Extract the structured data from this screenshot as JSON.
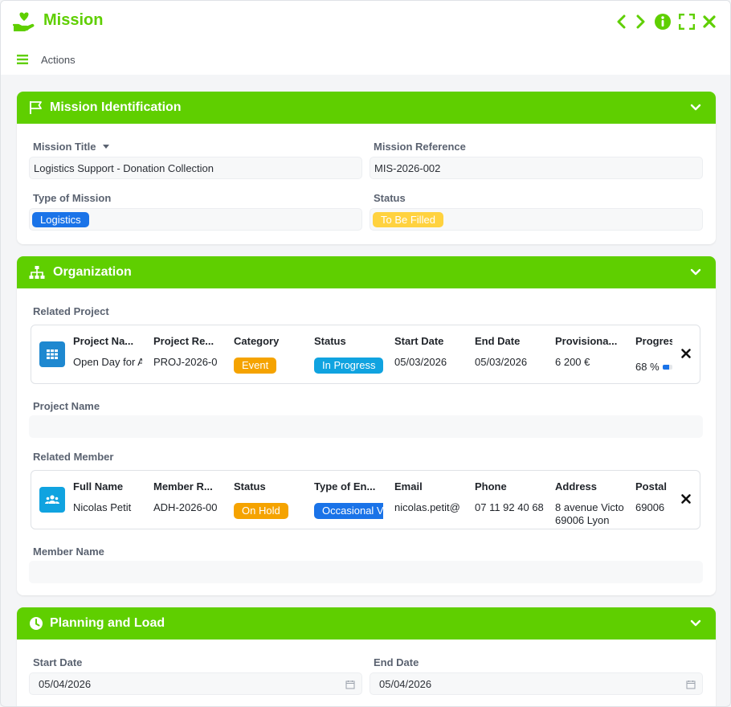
{
  "app": {
    "title": "Mission",
    "actions_label": "Actions"
  },
  "colors": {
    "accent": "#5fcf00",
    "blue": "#1a73e8",
    "cyan": "#10a3e0",
    "orange": "#f5a300",
    "yellow": "#ffd23f"
  },
  "identification": {
    "title": "Mission Identification",
    "mission_title_label": "Mission Title",
    "mission_title_value": "Logistics Support - Donation Collection",
    "reference_label": "Mission Reference",
    "reference_value": "MIS-2026-002",
    "type_label": "Type of Mission",
    "type_value": "Logistics",
    "status_label": "Status",
    "status_value": "To Be Filled"
  },
  "organization": {
    "title": "Organization",
    "related_project_label": "Related Project",
    "project": {
      "headers": [
        "Project Na...",
        "Project Re...",
        "Category",
        "Status",
        "Start Date",
        "End Date",
        "Provisiona...",
        "Progres"
      ],
      "name": "Open Day for A",
      "reference": "PROJ-2026-0",
      "category": "Event",
      "status": "In Progress",
      "start_date": "05/03/2026",
      "end_date": "05/03/2026",
      "budget": "6 200 €",
      "progress_text": "68 %",
      "progress": 0.68
    },
    "project_name_label": "Project Name",
    "related_member_label": "Related Member",
    "member": {
      "headers": [
        "Full Name",
        "Member R...",
        "Status",
        "Type of En...",
        "Email",
        "Phone",
        "Address",
        "Postal C"
      ],
      "full_name": "Nicolas Petit",
      "reference": "ADH-2026-00",
      "status": "On Hold",
      "type": "Occasional V",
      "email": "nicolas.petit@",
      "phone": "07 11 92 40 68",
      "address_line1": "8 avenue Victo",
      "address_line2": "69006 Lyon",
      "postal": "69006"
    },
    "member_name_label": "Member Name"
  },
  "planning": {
    "title": "Planning and Load",
    "start_label": "Start Date",
    "start_value": "05/04/2026",
    "end_label": "End Date",
    "end_value": "05/04/2026"
  }
}
